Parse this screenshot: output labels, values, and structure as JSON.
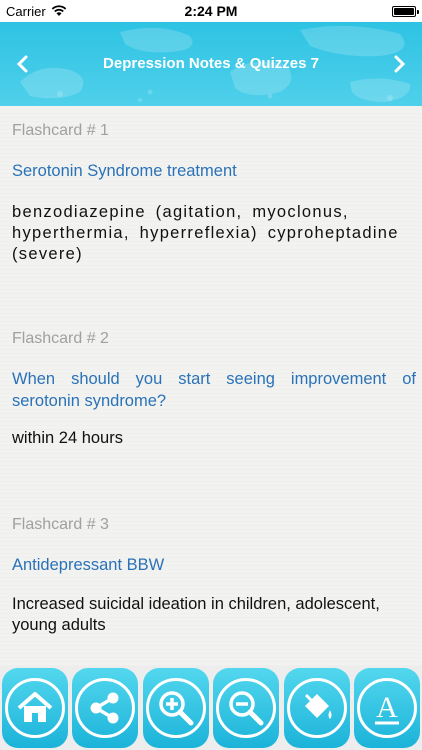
{
  "status_bar": {
    "carrier": "Carrier",
    "time": "2:24 PM"
  },
  "nav": {
    "title": "Depression Notes & Quizzes 7",
    "back_icon": "chevron-left-icon",
    "next_icon": "chevron-right-icon"
  },
  "cards": [
    {
      "label": "Flashcard # 1",
      "question": "Serotonin Syndrome treatment",
      "answer": "benzodiazepine (agitation, myoclonus, hyperthermia, hyperreflexia) cyproheptadine (severe)"
    },
    {
      "label": "Flashcard # 2",
      "question": "When should you start seeing improvement of serotonin syndrome?",
      "answer": "within 24 hours"
    },
    {
      "label": "Flashcard # 3",
      "question": "Antidepressant BBW",
      "answer": "Increased suicidal ideation in children, adolescent, young adults"
    }
  ],
  "toolbar": {
    "buttons": [
      "home-icon",
      "share-icon",
      "zoom-in-icon",
      "zoom-out-icon",
      "paint-bucket-icon",
      "font-icon"
    ],
    "font_glyph": "A"
  },
  "colors": {
    "accent": "#2ec3e3",
    "question_text": "#2a72b8",
    "label_text": "#a0a0a0"
  }
}
